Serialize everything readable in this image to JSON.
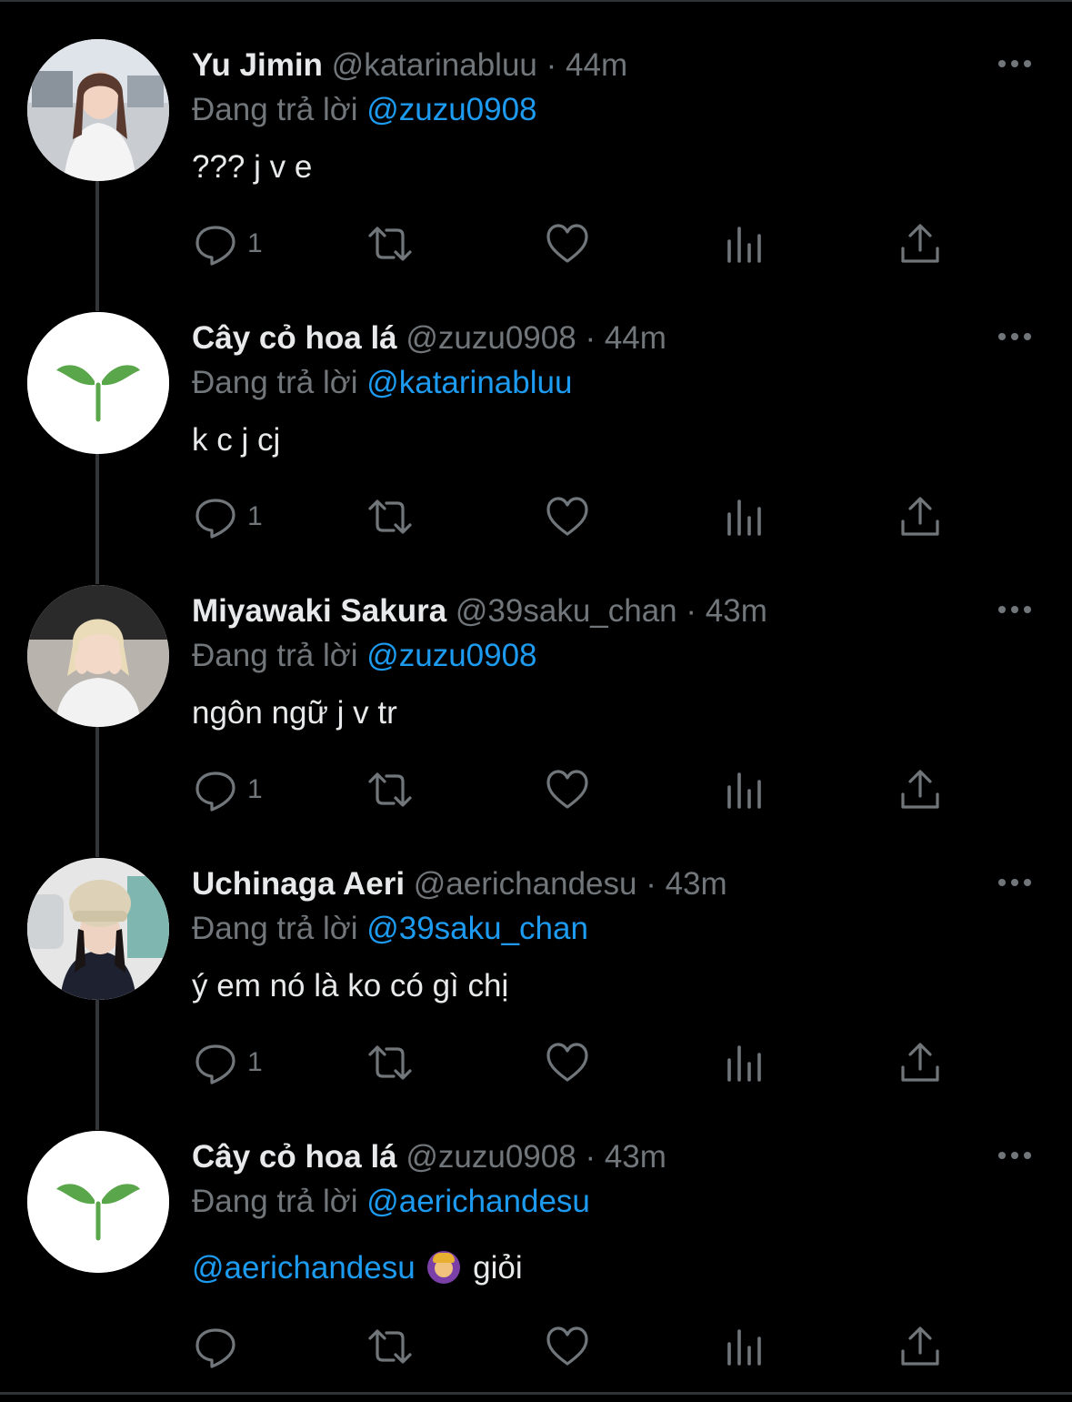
{
  "colors": {
    "background": "#000000",
    "text": "#e7e9ea",
    "muted": "#71767b",
    "accent": "#1d9bf0",
    "thread_line": "#333639"
  },
  "replying_prefix": "Đang trả lời",
  "tweets": [
    {
      "name": "Yu Jimin",
      "handle": "@katarinabluu",
      "dot": "·",
      "time": "44m",
      "reply_to": "@zuzu0908",
      "text": "??? j v e",
      "avatar": "photo-avatar",
      "reply_count": "1"
    },
    {
      "name": "Cây cỏ hoa lá",
      "handle": "@zuzu0908",
      "dot": "·",
      "time": "44m",
      "reply_to": "@katarinabluu",
      "text": "k c j cj",
      "avatar": "sprout-avatar",
      "reply_count": "1"
    },
    {
      "name": "Miyawaki Sakura",
      "handle": "@39saku_chan",
      "dot": "·",
      "time": "43m",
      "reply_to": "@zuzu0908",
      "text": "ngôn ngữ j v tr",
      "avatar": "photo-avatar",
      "reply_count": "1"
    },
    {
      "name": "Uchinaga Aeri",
      "handle": "@aerichandesu",
      "dot": "·",
      "time": "43m",
      "reply_to": "@39saku_chan",
      "text": "ý em nó là ko có gì chị",
      "avatar": "photo-avatar",
      "reply_count": "1"
    },
    {
      "name": "Cây cỏ hoa lá",
      "handle": "@zuzu0908",
      "dot": "·",
      "time": "43m",
      "reply_to": "@aerichandesu",
      "text_mention": "@aerichandesu",
      "emoji": "person-gesturing-ok-emoji",
      "text": "giỏi",
      "avatar": "sprout-avatar",
      "reply_count": ""
    }
  ]
}
